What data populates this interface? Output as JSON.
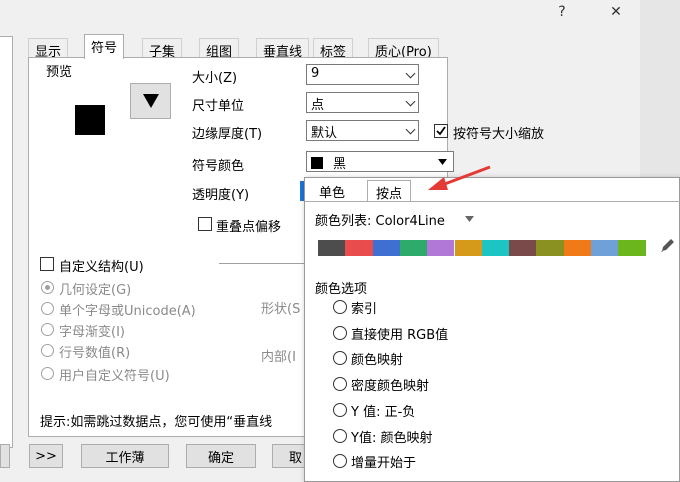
{
  "window": {
    "help_glyph": "?",
    "close_glyph": "✕"
  },
  "tabs": [
    "显示",
    "符号",
    "子集",
    "组图",
    "垂直线",
    "标签",
    "质心(Pro)"
  ],
  "preview_label": "预览",
  "fields": {
    "size_label": "大小(Z)",
    "size_value": "9",
    "unit_label": "尺寸单位",
    "unit_value": "点",
    "edge_label": "边缘厚度(T)",
    "edge_value": "默认",
    "scale_label": "按符号大小缩放",
    "color_label": "符号颜色",
    "color_value": "黑",
    "transparency_label": "透明度(Y)",
    "overlap_label": "重叠点偏移"
  },
  "custom": {
    "title": "自定义结构(U)",
    "options": [
      "几何设定(G)",
      "单个字母或Unicode(A)",
      "字母渐变(I)",
      "行号数值(R)",
      "用户自定义符号(U)"
    ],
    "shape_label": "形状(S",
    "inner_label": "内部(I"
  },
  "hint": "提示:如需跳过数据点，您可使用“垂直线",
  "buttons": {
    "more": ">>",
    "workbook": "工作薄",
    "ok": "确定",
    "cancel": "取"
  },
  "popup": {
    "tabs": [
      "单色",
      "按点"
    ],
    "palette_label": "颜色列表: Color4Line",
    "swatches": [
      "#4d4d4d",
      "#e84c4c",
      "#3f6fd0",
      "#2eaa6a",
      "#b278d8",
      "#d59a1a",
      "#1cc4c4",
      "#7a4a4a",
      "#8a9120",
      "#f07a18",
      "#6fa0d8",
      "#6ab61c"
    ],
    "section": "颜色选项",
    "options": [
      "索引",
      "直接使用 RGB值",
      "颜色映射",
      "密度颜色映射",
      "Y 值: 正-负",
      "Y值: 颜色映射",
      "增量开始于"
    ]
  },
  "colors": {
    "accent_arrow": "#e53935",
    "transparency_handle": "#1e73d8"
  }
}
